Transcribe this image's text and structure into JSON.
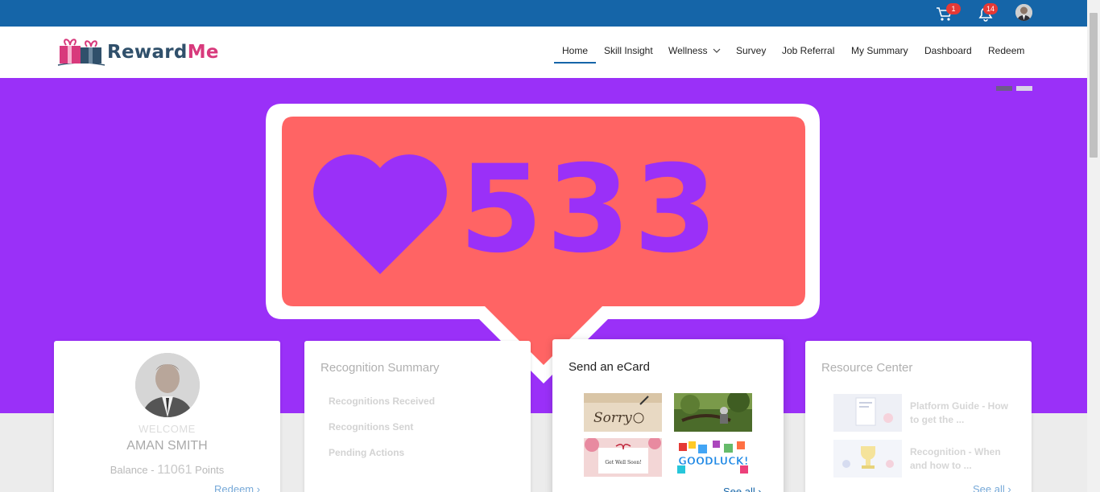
{
  "topbar": {
    "cart_count": "1",
    "notif_count": "14",
    "colors": {
      "bar": "#1565a8",
      "badge": "#e53935"
    }
  },
  "brand": {
    "name_part1": "Reward",
    "name_part2": "Me"
  },
  "nav": {
    "items": [
      "Home",
      "Skill Insight",
      "Wellness",
      "Survey",
      "Job Referral",
      "My Summary",
      "Dashboard",
      "Redeem"
    ],
    "active": "Home"
  },
  "hero": {
    "like_count": "533",
    "slides_total": 2,
    "slide_active": 1,
    "colors": {
      "background": "#9a30f8",
      "bubble": "#ff6464"
    }
  },
  "welcome_card": {
    "label": "WELCOME",
    "name": "AMAN SMITH",
    "balance_prefix": "Balance - ",
    "balance_points": "11061",
    "balance_suffix": " Points",
    "redeem_link": "Redeem"
  },
  "recognition_card": {
    "title": "Recognition Summary",
    "items": [
      "Recognitions Received",
      "Recognitions Sent",
      "Pending Actions"
    ]
  },
  "ecard_card": {
    "title": "Send an eCard",
    "cards": [
      "Sorry",
      "Nature",
      "Get Well Soon!",
      "GOODLUCK!"
    ],
    "see_all": "See all"
  },
  "resource_card": {
    "title": "Resource Center",
    "items": [
      "Platform Guide - How to get the ...",
      "Recognition - When and how to ..."
    ],
    "see_all": "See all"
  }
}
